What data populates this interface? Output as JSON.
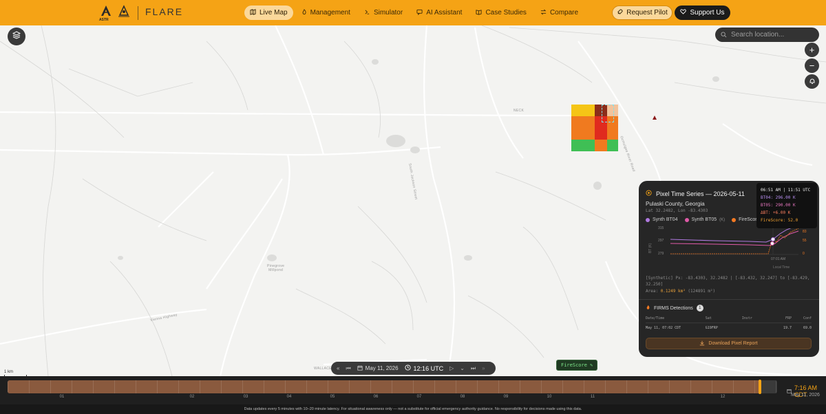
{
  "header": {
    "logo1_name": "ASTR",
    "logo3_name": "FLARE",
    "nav": [
      {
        "label": "Live Map",
        "icon": "map-icon",
        "active": true
      },
      {
        "label": "Management",
        "icon": "flame-icon"
      },
      {
        "label": "Simulator",
        "icon": "simulator-icon"
      },
      {
        "label": "AI Assistant",
        "icon": "chat-icon"
      },
      {
        "label": "Case Studies",
        "icon": "book-icon"
      },
      {
        "label": "Compare",
        "icon": "compare-icon"
      }
    ],
    "request_pilot": "Request Pilot",
    "support_us": "Support Us"
  },
  "map": {
    "search_placeholder": "Search location...",
    "scale_label": "1 km",
    "labels": {
      "neck": "NECK",
      "pond": "Pinegrove\nMillpond",
      "wallace": "WALLACE",
      "vienna_hwy": "Vienna Highway",
      "south_jackson": "South Jackson Street",
      "ocmulgee": "Ocmulgee River Road"
    }
  },
  "panel": {
    "title": "Pixel Time Series — 2026-05-11",
    "county": "Pulaski County, Georgia",
    "coords": "Lat 32.2482, Lon -83.4303",
    "legend": [
      "Synth BT04",
      "Synth BT05",
      "(K)",
      "FireScore"
    ],
    "chart_axis": {
      "y_left": [
        "315",
        "297",
        "279"
      ],
      "y_right": [
        "83",
        "55",
        "0"
      ],
      "x_tick": "07:01 AM",
      "x_label": "Local Time",
      "y_label": "BT (K)"
    },
    "pixel_text": "[Synthetic] Px: -83.4303, 32.2482 | [-83.432, 32.247] to [-83.429, 32.250]",
    "area_label": "Area: ",
    "area_value": "0.1249 km²",
    "area_extra": " (124891 m²)",
    "firms_title": "FIRMS Detections",
    "firms_count": "1",
    "firms_headers": [
      "Date/Time",
      "Sat",
      "Instr",
      "FRP",
      "Conf"
    ],
    "firms_row": [
      "May 11, 07:02 CDT",
      "G19FRP",
      "",
      "19.7",
      "69.0"
    ],
    "download": "Download Pixel Report"
  },
  "tooltip": {
    "time": "06:51 AM | 11:51 UTC",
    "bt04": "BT04: 296.00 K",
    "bt05": "BT05: 290.00 K",
    "dbt": "ΔBT: +6.00 K",
    "firescore": "FireScore: 52.0"
  },
  "playback": {
    "date": "May 11, 2026",
    "time": "12:16 UTC"
  },
  "firescore_badge": "FireScore",
  "timeline": {
    "ticks": [
      "01",
      "02",
      "03",
      "04",
      "05",
      "06",
      "07",
      "08",
      "09",
      "10",
      "11",
      "12"
    ],
    "current_time": "7:16 AM CDT",
    "current_date": "May 11, 2026",
    "progress": 0.978
  },
  "footer": "Data updates every 5 minutes with 10–20 minute latency. For situational awareness only — not a substitute for official emergency authority guidance. No responsibility for decisions made using this data.",
  "colors": {
    "accent": "#f5a315",
    "panel": "#262626",
    "bt04": "#b07ae0",
    "bt05": "#e05aa8",
    "firescore": "#f57a22"
  }
}
